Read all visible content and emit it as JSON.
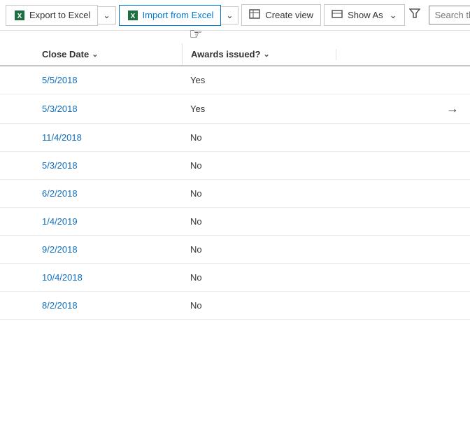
{
  "toolbar": {
    "export_label": "Export to Excel",
    "import_label": "Import from Excel",
    "create_view_label": "Create view",
    "show_as_label": "Show As",
    "search_placeholder": "Search this view",
    "filter_icon": "⚗",
    "search_icon": "🔍",
    "chevron_icon": "∨"
  },
  "table": {
    "columns": [
      {
        "id": "close_date",
        "label": "Close Date",
        "sortable": true
      },
      {
        "id": "awards_issued",
        "label": "Awards issued?",
        "sortable": true
      }
    ],
    "rows": [
      {
        "close_date": "5/5/2018",
        "awards_issued": "Yes",
        "has_arrow": false
      },
      {
        "close_date": "5/3/2018",
        "awards_issued": "Yes",
        "has_arrow": true
      },
      {
        "close_date": "11/4/2018",
        "awards_issued": "No",
        "has_arrow": false
      },
      {
        "close_date": "5/3/2018",
        "awards_issued": "No",
        "has_arrow": false
      },
      {
        "close_date": "6/2/2018",
        "awards_issued": "No",
        "has_arrow": false
      },
      {
        "close_date": "1/4/2019",
        "awards_issued": "No",
        "has_arrow": false
      },
      {
        "close_date": "9/2/2018",
        "awards_issued": "No",
        "has_arrow": false
      },
      {
        "close_date": "10/4/2018",
        "awards_issued": "No",
        "has_arrow": false
      },
      {
        "close_date": "8/2/2018",
        "awards_issued": "No",
        "has_arrow": false
      }
    ]
  }
}
